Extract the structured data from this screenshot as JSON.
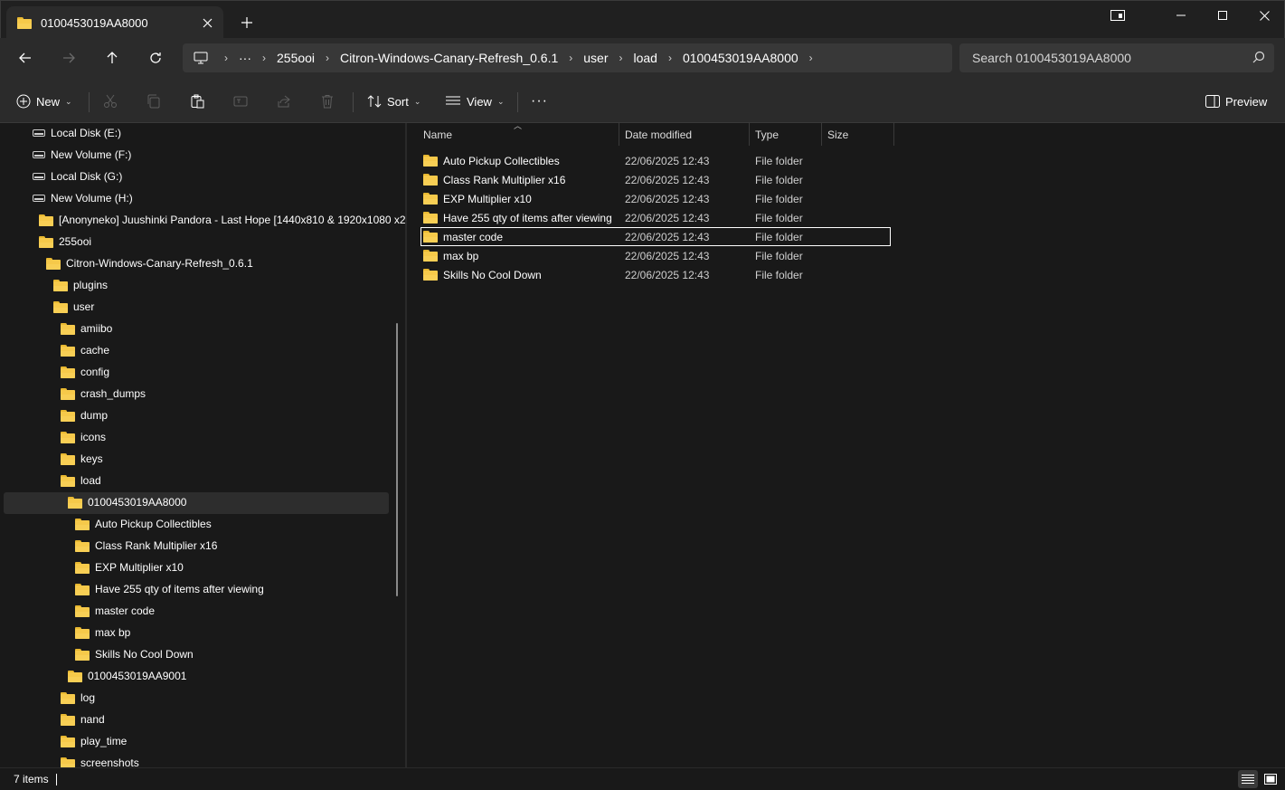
{
  "window": {
    "tab_title": "0100453019AA8000"
  },
  "address": {
    "crumbs": [
      "255ooi",
      "Citron-Windows-Canary-Refresh_0.6.1",
      "user",
      "load",
      "0100453019AA8000"
    ],
    "ellipsis": "···",
    "search_placeholder": "Search 0100453019AA8000"
  },
  "toolbar": {
    "new_label": "New",
    "sort_label": "Sort",
    "view_label": "View",
    "more_label": "···",
    "preview_label": "Preview"
  },
  "nav": {
    "drives": [
      {
        "label": "Local Disk (E:)"
      },
      {
        "label": "New Volume (F:)"
      },
      {
        "label": "Local Disk (G:)"
      },
      {
        "label": "New Volume (H:)"
      }
    ],
    "folders": [
      {
        "label": "[Anonyneko] Juushinki Pandora - Last Hope [1440x810 & 1920x1080 x2"
      },
      {
        "label": "255ooi"
      },
      {
        "label": "Citron-Windows-Canary-Refresh_0.6.1"
      },
      {
        "label": "plugins"
      },
      {
        "label": "user"
      },
      {
        "label": "amiibo"
      },
      {
        "label": "cache"
      },
      {
        "label": "config"
      },
      {
        "label": "crash_dumps"
      },
      {
        "label": "dump"
      },
      {
        "label": "icons"
      },
      {
        "label": "keys"
      },
      {
        "label": "load"
      },
      {
        "label": "0100453019AA8000"
      },
      {
        "label": "Auto Pickup Collectibles"
      },
      {
        "label": "Class Rank Multiplier x16"
      },
      {
        "label": "EXP Multiplier x10"
      },
      {
        "label": "Have 255 qty of items after viewing"
      },
      {
        "label": "master code"
      },
      {
        "label": "max bp"
      },
      {
        "label": "Skills No Cool Down"
      },
      {
        "label": "0100453019AA9001"
      },
      {
        "label": "log"
      },
      {
        "label": "nand"
      },
      {
        "label": "play_time"
      },
      {
        "label": "screenshots"
      }
    ]
  },
  "columns": {
    "name": "Name",
    "date": "Date modified",
    "type": "Type",
    "size": "Size"
  },
  "files": [
    {
      "name": "Auto Pickup Collectibles",
      "date": "22/06/2025 12:43",
      "type": "File folder"
    },
    {
      "name": "Class Rank Multiplier x16",
      "date": "22/06/2025 12:43",
      "type": "File folder"
    },
    {
      "name": "EXP Multiplier x10",
      "date": "22/06/2025 12:43",
      "type": "File folder"
    },
    {
      "name": "Have 255 qty of items after viewing",
      "date": "22/06/2025 12:43",
      "type": "File folder"
    },
    {
      "name": "master code",
      "date": "22/06/2025 12:43",
      "type": "File folder"
    },
    {
      "name": "max bp",
      "date": "22/06/2025 12:43",
      "type": "File folder"
    },
    {
      "name": "Skills No Cool Down",
      "date": "22/06/2025 12:43",
      "type": "File folder"
    }
  ],
  "status": {
    "item_count": "7 items"
  },
  "colors": {
    "folder": "#f6c94a",
    "background": "#191919",
    "toolbar": "#2b2b2b"
  }
}
